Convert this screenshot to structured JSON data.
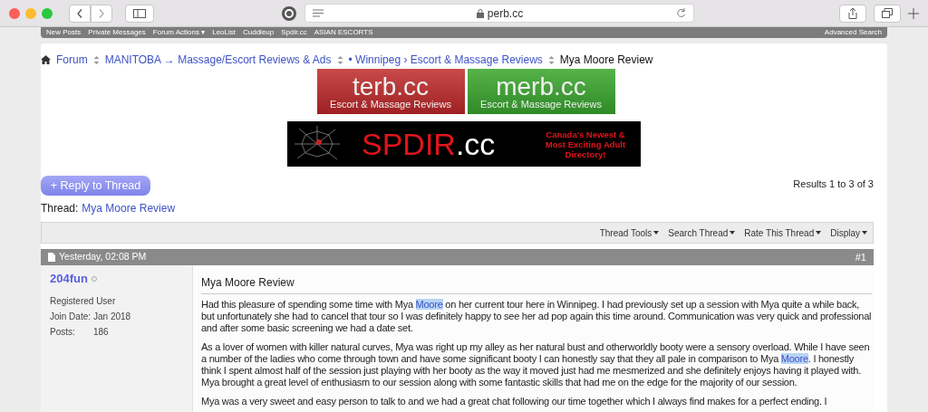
{
  "browser": {
    "address": "perb.cc"
  },
  "nav": {
    "links": [
      "New Posts",
      "Private Messages",
      "Forum Actions ▾",
      "LeoList",
      "Cuddleup",
      "Spdir.cc",
      "ASIAN ESCORTS"
    ],
    "right": "Advanced Search"
  },
  "breadcrumb": [
    {
      "label": "Forum",
      "kind": "home"
    },
    {
      "label": "MANITOBA → Massage/Escort Reviews & Ads",
      "kind": "link"
    },
    {
      "label": "• Winnipeg › Escort & Massage Reviews",
      "kind": "link"
    },
    {
      "label": "Mya Moore Review",
      "kind": "current"
    }
  ],
  "banners": [
    {
      "kind": "terb",
      "title": "terb.cc",
      "subtitle": "Escort & Massage Reviews"
    },
    {
      "kind": "merb",
      "title": "merb.cc",
      "subtitle": "Escort & Massage Reviews"
    }
  ],
  "wide_banner": {
    "title": "SPDIR",
    "suffix": ".cc",
    "tagline": "Canada's Newest & Most Exciting Adult Directory!"
  },
  "reply_button": "+ Reply to Thread",
  "results": "Results 1 to 3 of 3",
  "thread": {
    "label": "Thread:",
    "title": "Mya Moore Review"
  },
  "tools": [
    "Thread Tools",
    "Search Thread",
    "Rate This Thread",
    "Display"
  ],
  "post": {
    "date": "Yesterday, 02:08 PM",
    "number": "#1",
    "user": {
      "name": "204fun",
      "online": false,
      "rank": "Registered User",
      "fields": [
        {
          "label": "Join Date:",
          "value": "Jan 2018"
        },
        {
          "label": "Posts:",
          "value": "186"
        }
      ]
    },
    "title": "Mya Moore Review",
    "paragraphs": [
      [
        {
          "text": "Had this pleasure of spending some time with Mya ",
          "highlighted": false
        },
        {
          "text": "Moore",
          "highlighted": true
        },
        {
          "text": " on her current tour here in Winnipeg. I had previously set up a session with Mya quite a while back, but unfortunately she had to cancel that tour so I was definitely happy to see her ad pop again this time around. Communication was very quick and professional and after some basic screening we had a date set.",
          "highlighted": false
        }
      ],
      [
        {
          "text": "As a lover of women with killer natural curves, Mya was right up my alley as her natural bust and otherworldly booty were a sensory overload. While I have seen a number of the ladies who come through town and have some significant booty I can honestly say that they all pale in comparison to Mya ",
          "highlighted": false
        },
        {
          "text": "Moore",
          "highlighted": true
        },
        {
          "text": ". I honestly think I spent almost half of the session just playing with her booty as the way it moved just had me mesmerized and she definitely enjoys having it played with. Mya brought a great level of enthusiasm to our session along with some fantastic skills that had me on the edge for the majority of our session.",
          "highlighted": false
        }
      ],
      [
        {
          "text": "Mya was a very sweet and easy person to talk to and we had a great chat following our time together which I always find makes for a perfect ending. I",
          "highlighted": false
        }
      ]
    ]
  }
}
